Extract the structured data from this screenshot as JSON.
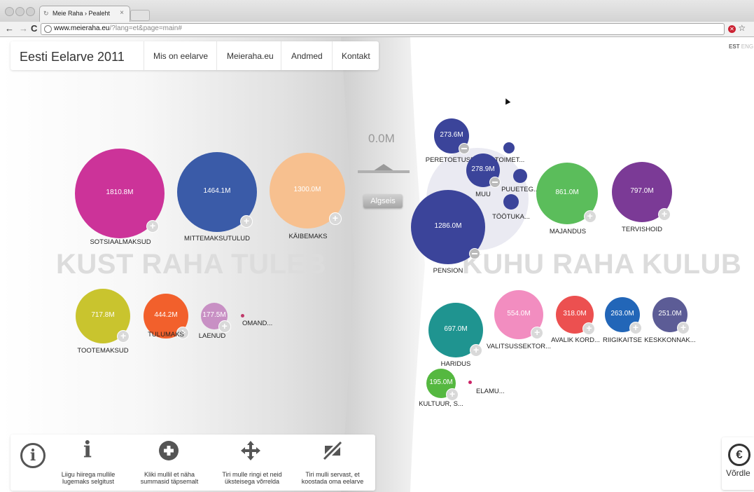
{
  "browser": {
    "tab_title": "Meie Raha › Pealeht",
    "tab_close": "×",
    "url_host": "www.meieraha.eu",
    "url_query": "/?lang=et&page=main#"
  },
  "site": {
    "title": "Eesti Eelarve 2011",
    "nav": [
      "Mis on eelarve",
      "Meieraha.eu",
      "Andmed",
      "Kontakt"
    ],
    "lang_active": "EST",
    "lang_other": "ENG"
  },
  "headings": {
    "left": "KUST RAHA TULEB",
    "right": "KUHU RAHA KULUB"
  },
  "center": {
    "total": "0.0M",
    "reset_label": "Algseis"
  },
  "income": [
    {
      "value": "1810.8M",
      "label": "SOTSIAALMAKSUD",
      "color": "#cc3399"
    },
    {
      "value": "1464.1M",
      "label": "MITTEMAKSUTULUD",
      "color": "#3a5ba8"
    },
    {
      "value": "1300.0M",
      "label": "KÄIBEMAKS",
      "color": "#f7c08f"
    },
    {
      "value": "717.8M",
      "label": "TOOTEMAKSUD",
      "color": "#c9c42e"
    },
    {
      "value": "444.2M",
      "label": "TULUMAKS",
      "color": "#f2602c"
    },
    {
      "value": "177.5M",
      "label": "LAENUD",
      "color": "#c890c4"
    },
    {
      "value": "",
      "label": "OMAND...",
      "color": "#c03a6b"
    }
  ],
  "expenses": [
    {
      "value": "273.6M",
      "label": "PERETOETUSE...",
      "color": "#3b449a"
    },
    {
      "value": "",
      "label": "TOIMET...",
      "color": "#3b449a"
    },
    {
      "value": "278.9M",
      "label": "MUU",
      "color": "#3b449a"
    },
    {
      "value": "",
      "label": "PUUETEG...",
      "color": "#3b449a"
    },
    {
      "value": "",
      "label": "TÖÖTUKA...",
      "color": "#3b449a"
    },
    {
      "value": "1286.0M",
      "label": "PENSION",
      "color": "#3b449a"
    },
    {
      "value": "861.0M",
      "label": "MAJANDUS",
      "color": "#5bbd5b"
    },
    {
      "value": "797.0M",
      "label": "TERVISHOID",
      "color": "#7b3a96"
    },
    {
      "value": "697.0M",
      "label": "HARIDUS",
      "color": "#1f9490"
    },
    {
      "value": "554.0M",
      "label": "VALITSUSSEKTOR...",
      "color": "#f28dc0"
    },
    {
      "value": "318.0M",
      "label": "AVALIK KORD...",
      "color": "#ec5050"
    },
    {
      "value": "263.0M",
      "label": "RIIGIKAITSE",
      "color": "#2266b8"
    },
    {
      "value": "251.0M",
      "label": "KESKKONNAK...",
      "color": "#5c5c96"
    },
    {
      "value": "195.0M",
      "label": "KULTUUR, S...",
      "color": "#55b840"
    },
    {
      "value": "",
      "label": "ELAMU...",
      "color": "#cc2266"
    }
  ],
  "help": [
    {
      "text": "Liigu hiirega mullile lugemaks selgitust",
      "icon": "info-letter-icon"
    },
    {
      "text": "Kliki mullil et näha summasid täpsemalt",
      "icon": "plus-circle-icon"
    },
    {
      "text": "Tiri mulle ringi et neid üksteisega võrrelda",
      "icon": "move-arrows-icon"
    },
    {
      "text": "Tiri mulli servast, et koostada oma eelarve",
      "icon": "resize-slash-icon"
    }
  ],
  "compare": {
    "label": "Võrdle",
    "icon": "euro-icon"
  }
}
